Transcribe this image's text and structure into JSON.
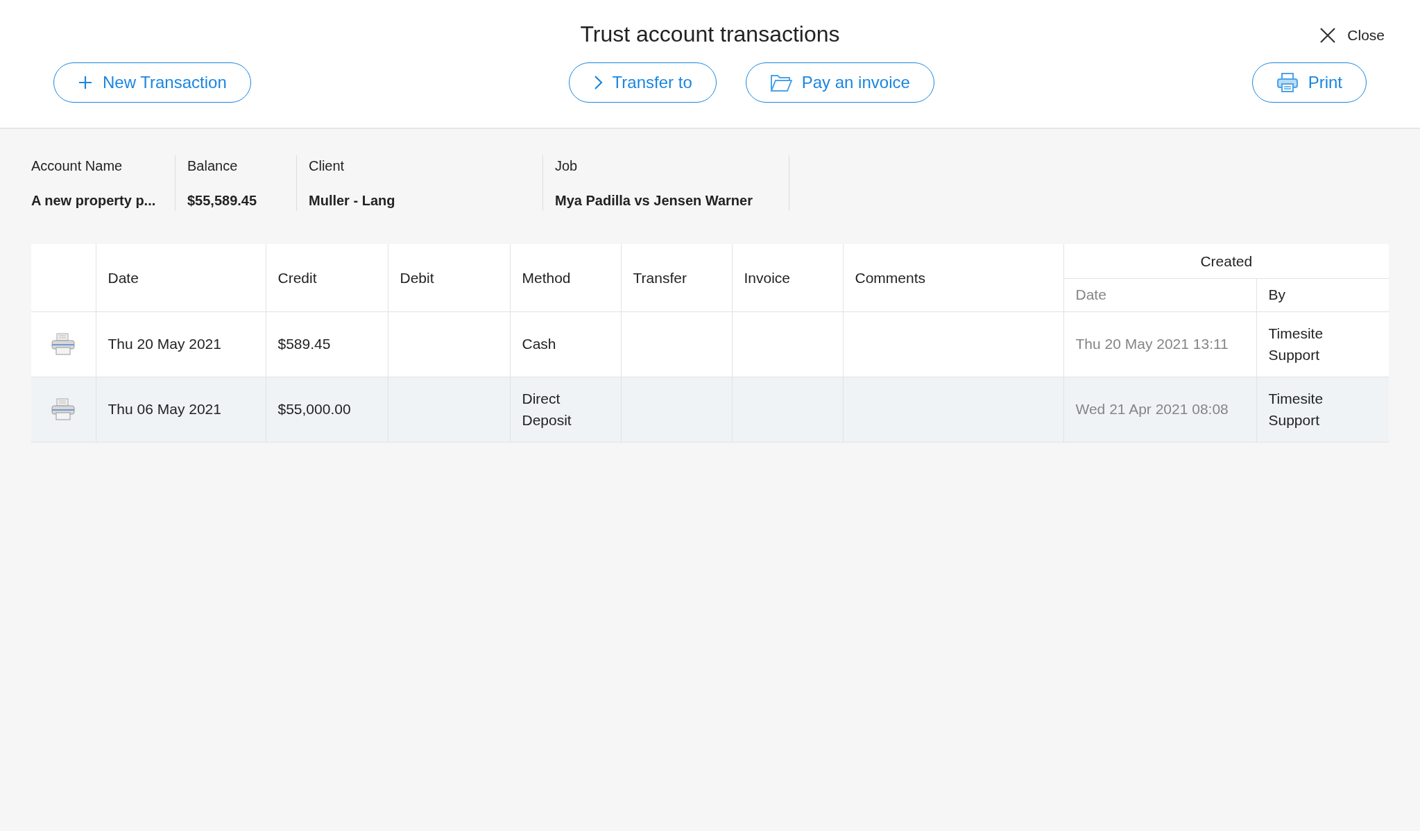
{
  "title": "Trust account transactions",
  "close": {
    "label": "Close"
  },
  "actions": [
    {
      "kind": "plus",
      "label": "New Transaction"
    },
    {
      "kind": "chevron",
      "label": "Transfer to"
    },
    {
      "kind": "folder",
      "label": "Pay an invoice"
    },
    {
      "kind": "printer",
      "label": "Print"
    }
  ],
  "summary": [
    {
      "label": "Account Name",
      "value": "A new property p..."
    },
    {
      "label": "Balance",
      "value": "$55,589.45"
    },
    {
      "label": "Client",
      "value": "Muller - Lang"
    },
    {
      "label": "Job",
      "value": "Mya Padilla vs Jensen Warner"
    }
  ],
  "table": {
    "columns": [
      "Date",
      "Credit",
      "Debit",
      "Method",
      "Transfer",
      "Invoice",
      "Comments"
    ],
    "group_header": "Created",
    "sub_columns": [
      "Date",
      "By"
    ],
    "rows": [
      {
        "selected": false,
        "date": "Thu 20 May 2021",
        "credit": "$589.45",
        "debit": "",
        "method": "Cash",
        "transfer": "",
        "invoice": "",
        "comments": "",
        "created_date": "Thu 20 May 2021 13:11",
        "created_by": "Timesite Support"
      },
      {
        "selected": true,
        "date": "Thu 06 May 2021",
        "credit": "$55,000.00",
        "debit": "",
        "method": "Direct Deposit",
        "transfer": "",
        "invoice": "",
        "comments": "",
        "created_date": "Wed 21 Apr 2021 08:08",
        "created_by": "Timesite Support"
      }
    ]
  }
}
